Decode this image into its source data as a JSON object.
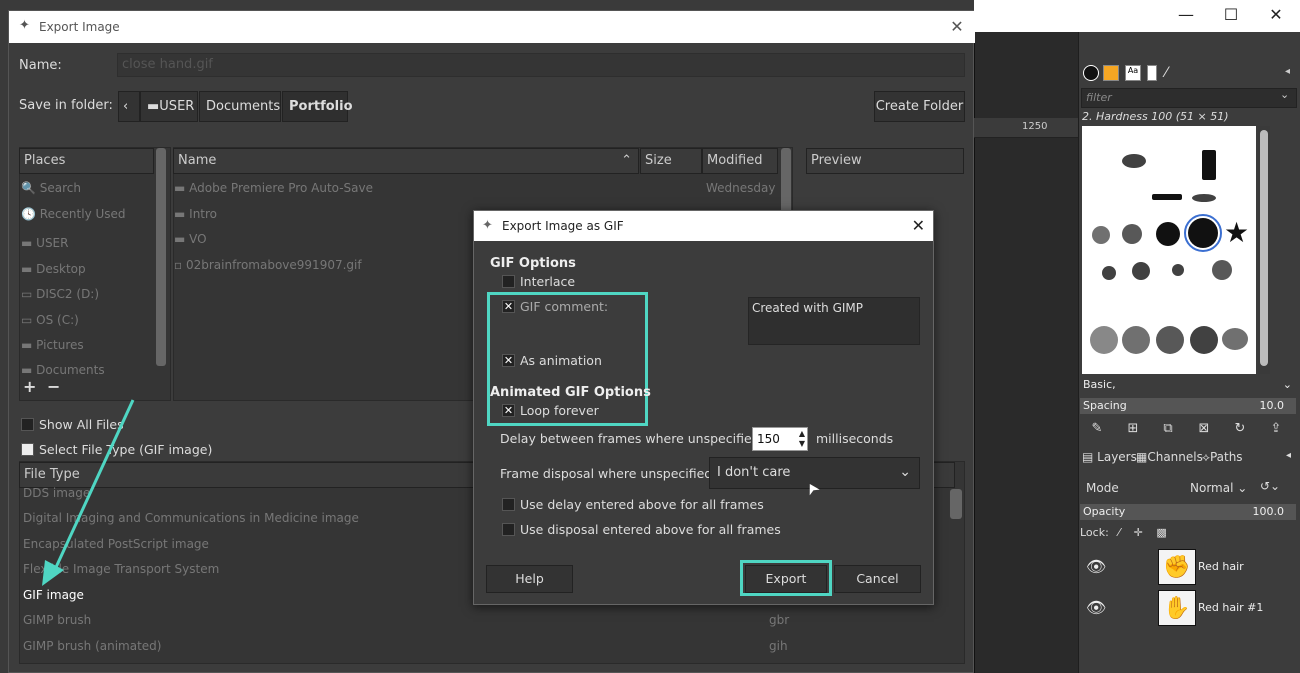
{
  "gimp": {
    "window_min": "—",
    "window_max": "☐",
    "window_close": "✕",
    "ruler_label": "1250",
    "brush_filter_placeholder": "filter",
    "brush_title": "2. Hardness 100 (51 × 51)",
    "brush_preset": "Basic,",
    "spacing_label": "Spacing",
    "spacing_value": "10.0",
    "tabs": [
      "Layers",
      "Channels",
      "Paths"
    ],
    "mode_label": "Mode",
    "mode_value": "Normal",
    "opacity_label": "Opacity",
    "opacity_value": "100.0",
    "lock_label": "Lock:",
    "layers": [
      {
        "name": "Red hair"
      },
      {
        "name": "Red hair #1"
      }
    ]
  },
  "export_dialog": {
    "title": "Export Image",
    "name_label": "Name:",
    "name_value": "close hand.gif",
    "save_in_label": "Save in folder:",
    "breadcrumbs": [
      "USER",
      "Documents",
      "Portfolio"
    ],
    "create_folder": "Create Folder",
    "places_header": "Places",
    "places": [
      "Search",
      "Recently Used",
      "USER",
      "Desktop",
      "DISC2 (D:)",
      "OS (C:)",
      "Pictures",
      "Documents"
    ],
    "columns": {
      "name": "Name",
      "size": "Size",
      "modified": "Modified"
    },
    "files": [
      {
        "name": "Adobe Premiere Pro Auto-Save",
        "modified": "Wednesday"
      },
      {
        "name": "Intro",
        "modified": ""
      },
      {
        "name": "VO",
        "modified": ""
      },
      {
        "name": "02brainfromabove991907.gif",
        "modified": ""
      }
    ],
    "preview_header": "Preview",
    "show_all_files": "Show All Files",
    "select_file_type": "Select File Type (GIF image)",
    "file_type_header": "File Type",
    "file_types": [
      {
        "name": "DDS image",
        "ext": ""
      },
      {
        "name": "Digital Imaging and Communications in Medicine image",
        "ext": ""
      },
      {
        "name": "Encapsulated PostScript image",
        "ext": ""
      },
      {
        "name": "Flexible Image Transport System",
        "ext": ""
      },
      {
        "name": "GIF image",
        "ext": ""
      },
      {
        "name": "GIMP brush",
        "ext": "gbr"
      },
      {
        "name": "GIMP brush (animated)",
        "ext": "gih"
      }
    ],
    "add_symbol": "+",
    "remove_symbol": "−"
  },
  "gif_dialog": {
    "title": "Export Image as GIF",
    "gif_options": "GIF Options",
    "interlace": "Interlace",
    "gif_comment": "GIF comment:",
    "comment_text": "Created with GIMP",
    "as_animation": "As animation",
    "animated_options": "Animated GIF Options",
    "loop_forever": "Loop forever",
    "delay_label": "Delay between frames where unspecified:",
    "delay_value": "150",
    "delay_unit": "milliseconds",
    "disposal_label": "Frame disposal where unspecified:",
    "disposal_value": "I don't care",
    "use_delay": "Use delay entered above for all frames",
    "use_disposal": "Use disposal entered above for all frames",
    "help": "Help",
    "export": "Export",
    "cancel": "Cancel",
    "checked": {
      "interlace": false,
      "gif_comment": true,
      "as_animation": true,
      "loop_forever": true,
      "use_delay": false,
      "use_disposal": false
    }
  },
  "colors": {
    "highlight": "#4fd6c3",
    "dialog_bg": "#3c3c3c",
    "titlebar": "#ffffff"
  }
}
